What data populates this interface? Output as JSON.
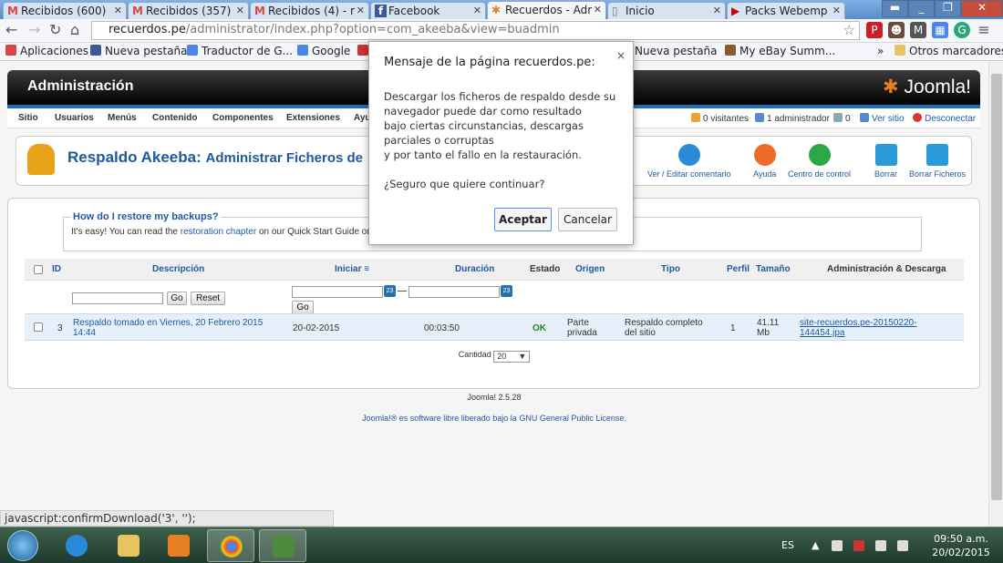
{
  "browser": {
    "tabs": [
      {
        "icon": "M",
        "label": "Recibidos (600)",
        "active": false
      },
      {
        "icon": "M",
        "label": "Recibidos (357)",
        "active": false
      },
      {
        "icon": "M",
        "label": "Recibidos (4) - r",
        "active": false
      },
      {
        "icon": "f",
        "label": "Facebook",
        "active": false
      },
      {
        "icon": "J",
        "label": "Recuerdos - Adr",
        "active": true
      },
      {
        "icon": "",
        "label": "Inicio",
        "active": false
      },
      {
        "icon": "▶",
        "label": "Packs Webemp",
        "active": false
      }
    ],
    "url_prefix": "recuerdos.pe",
    "url_rest": "/administrator/index.php?option=com_akeeba&view=buadmin",
    "bookmarks": [
      {
        "label": "Aplicaciones",
        "color": "#d44"
      },
      {
        "label": "Nueva pestaña",
        "color": "#3b5998"
      },
      {
        "label": "Traductor de G...",
        "color": "#4a86e8"
      },
      {
        "label": "Google",
        "color": "#4a86e8"
      },
      {
        "label": "Nueva pestaña",
        "color": "#c33"
      },
      {
        "label": "My eBay Summ...",
        "color": "#8b5a2b"
      }
    ],
    "bookmarks_more": "»",
    "other_bookmarks": "Otros marcadores",
    "status_url": "javascript:confirmDownload('3', '');"
  },
  "admin": {
    "header_title": "Administración",
    "brand": "Joomla!",
    "menu": [
      "Sitio",
      "Usuarios",
      "Menús",
      "Contenido",
      "Componentes",
      "Extensiones",
      "Ayu"
    ],
    "status": {
      "visitors": "0 visitantes",
      "admins": "1 administrador",
      "messages": "0",
      "view_site": "Ver sitio",
      "logout": "Desconectar"
    },
    "page_title": "Respaldo Akeeba:",
    "page_subtitle": "Administrar Ficheros de",
    "toolbar": {
      "edit_comment": "Ver / Editar comentario",
      "help": "Ayuda",
      "control_center": "Centro de control",
      "delete": "Borrar",
      "delete_files": "Borrar Ficheros"
    },
    "restore": {
      "legend": "How do I restore my backups?",
      "text_before": "It's easy! You can read the",
      "link": "restoration chapter",
      "text_after": "on our Quick Start Guide or w"
    },
    "grid": {
      "headers": [
        "ID",
        "Descripción",
        "Iniciar",
        "Duración",
        "Estado",
        "Origen",
        "Tipo",
        "Perfil",
        "Tamaño",
        "Administración & Descarga"
      ],
      "go_label": "Go",
      "reset_label": "Reset",
      "go2_label": "Go",
      "cal_label": "23",
      "date_sep": "—",
      "row": {
        "id": "3",
        "description": "Respaldo tomado en Viernes, 20 Febrero 2015 14:44",
        "start": "20-02-2015",
        "duration": "00:03:50",
        "status": "OK",
        "origin": "Parte privada",
        "type": "Respaldo completo del sitio",
        "profile": "1",
        "size": "41.11 Mb",
        "download": "site-recuerdos.pe-20150220-144454.jpa"
      },
      "quantity_label": "Cantidad",
      "quantity_value": "20"
    },
    "footer_version": "Joomla! 2.5.28",
    "footer_license_before": "Joomla!® es software libre liberado bajo la",
    "footer_license_link": "GNU General Public License",
    "footer_license_after": "."
  },
  "dialog": {
    "title": "Mensaje de la página recuerdos.pe:",
    "close": "×",
    "message": "Descargar los ficheros de respaldo desde su navegador puede dar como resultado\nbajo ciertas circunstancias, descargas parciales o corruptas\ny por tanto el fallo en la restauración.",
    "question": "¿Seguro que quiere continuar?",
    "ok": "Aceptar",
    "cancel": "Cancelar"
  },
  "taskbar": {
    "lang": "ES",
    "time": "09:50 a.m.",
    "date": "20/02/2015"
  }
}
